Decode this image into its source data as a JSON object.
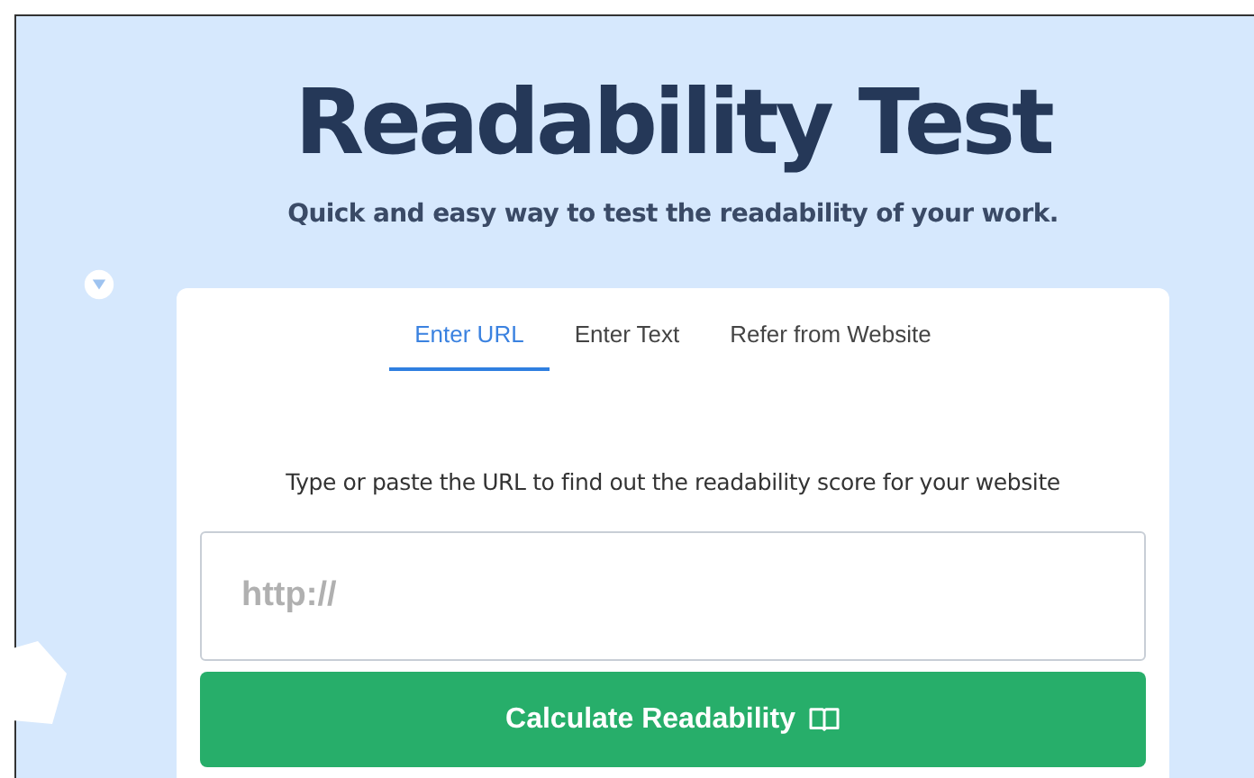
{
  "title": "Readability Test",
  "subtitle": "Quick and easy way to test the readability of your work.",
  "tabs": [
    {
      "label": "Enter URL",
      "selected": true
    },
    {
      "label": "Enter Text",
      "selected": false
    },
    {
      "label": "Refer from Website",
      "selected": false
    }
  ],
  "instruction": "Type or paste the URL to find out the readability score for your website",
  "url_field": {
    "placeholder": "http://"
  },
  "button": {
    "label": "Calculate Readability"
  }
}
